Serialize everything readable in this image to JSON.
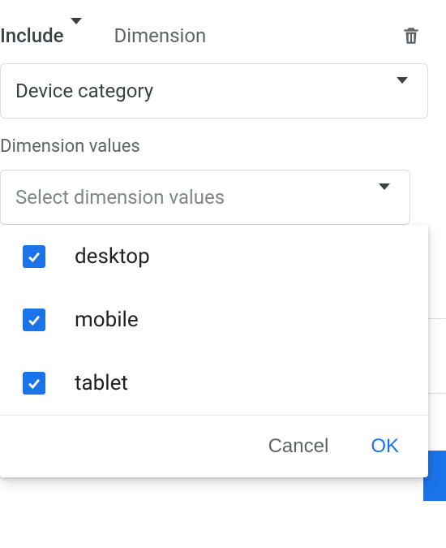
{
  "header": {
    "include_label": "Include",
    "dimension_label": "Dimension"
  },
  "dimension_select": {
    "value": "Device category"
  },
  "values_section": {
    "label": "Dimension values",
    "placeholder": "Select dimension values"
  },
  "options": [
    {
      "label": "desktop",
      "checked": true
    },
    {
      "label": "mobile",
      "checked": true
    },
    {
      "label": "tablet",
      "checked": true
    }
  ],
  "buttons": {
    "cancel": "Cancel",
    "ok": "OK"
  }
}
